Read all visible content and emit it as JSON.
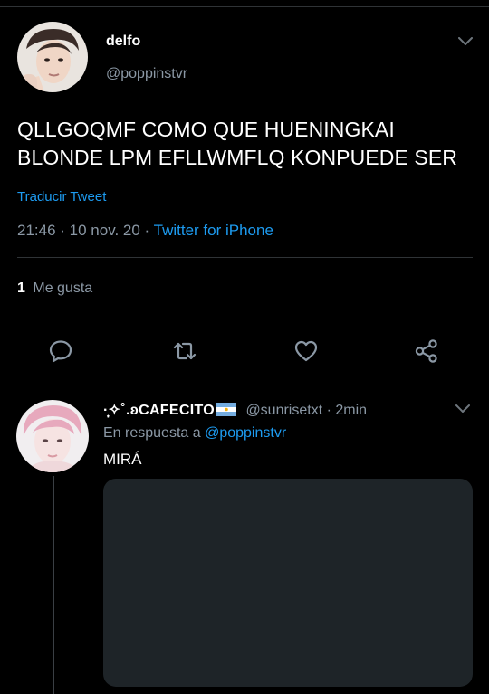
{
  "tweet": {
    "author_name": "delfo",
    "author_handle": "@poppinstvr",
    "text": "QLLGOQMF COMO QUE HUENINGKAI BLONDE LPM EFLLWMFLQ KONPUEDE SER",
    "translate_label": "Traducir Tweet",
    "time": "21:46",
    "date": "10 nov. 20",
    "source": "Twitter for iPhone",
    "likes_count": "1",
    "likes_label": "Me gusta"
  },
  "actions": {
    "reply_icon": "reply-icon",
    "retweet_icon": "retweet-icon",
    "like_icon": "heart-icon",
    "share_icon": "share-icon"
  },
  "reply": {
    "author_name": "·̩͙✧˚.ʚCAFECITO",
    "author_flag": "argentina-flag-emoji",
    "author_handle": "@sunrisetxt",
    "time": "2min",
    "replying_to_label": "En respuesta a",
    "replying_to_handle": "@poppinstvr",
    "text": "MIRÁ"
  },
  "colors": {
    "background": "#000000",
    "text": "#ffffff",
    "secondary": "#8b98a5",
    "accent": "#1d9bf0",
    "separator": "#2f3336",
    "media_placeholder": "#1e2428"
  }
}
